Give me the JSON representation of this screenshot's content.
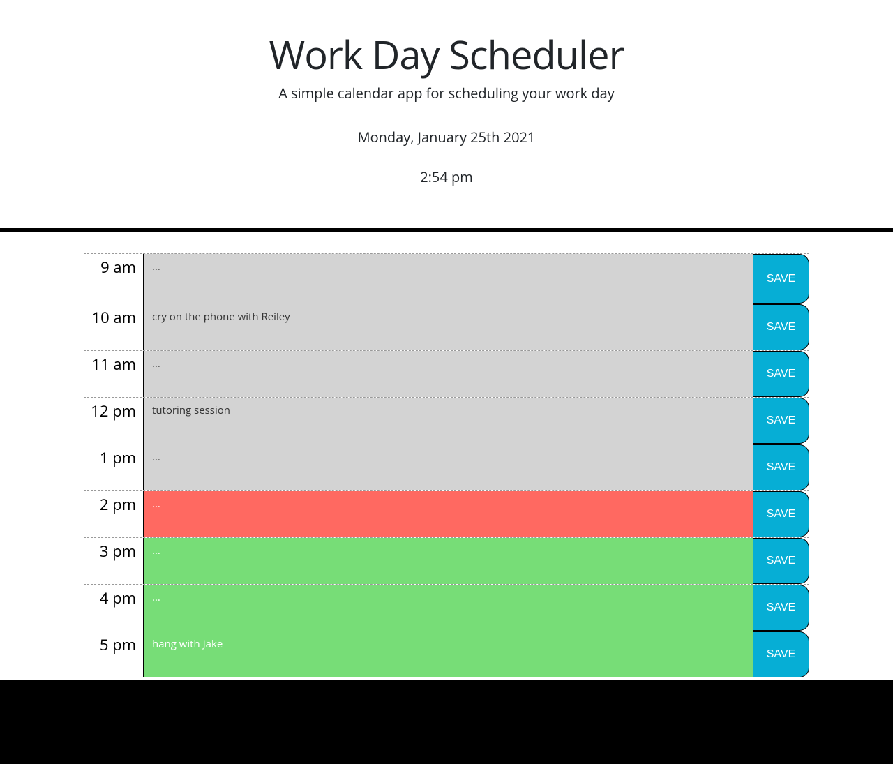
{
  "header": {
    "title": "Work Day Scheduler",
    "subtitle": "A simple calendar app for scheduling your work day",
    "current_date": "Monday, January 25th 2021",
    "current_time": "2:54 pm"
  },
  "colors": {
    "past": "#d3d3d3",
    "present": "#ff6961",
    "future": "#77dd77",
    "save_button": "#06aed5"
  },
  "rows": [
    {
      "hour": "9 am",
      "state": "past",
      "value": "",
      "placeholder": "...",
      "save_label": "SAVE"
    },
    {
      "hour": "10 am",
      "state": "past",
      "value": "cry on the phone with Reiley",
      "placeholder": "...",
      "save_label": "SAVE"
    },
    {
      "hour": "11 am",
      "state": "past",
      "value": "",
      "placeholder": "...",
      "save_label": "SAVE"
    },
    {
      "hour": "12 pm",
      "state": "past",
      "value": "tutoring session",
      "placeholder": "...",
      "save_label": "SAVE"
    },
    {
      "hour": "1 pm",
      "state": "past",
      "value": "",
      "placeholder": "...",
      "save_label": "SAVE"
    },
    {
      "hour": "2 pm",
      "state": "present",
      "value": "",
      "placeholder": "...",
      "save_label": "SAVE"
    },
    {
      "hour": "3 pm",
      "state": "future",
      "value": "",
      "placeholder": "...",
      "save_label": "SAVE"
    },
    {
      "hour": "4 pm",
      "state": "future",
      "value": "",
      "placeholder": "...",
      "save_label": "SAVE"
    },
    {
      "hour": "5 pm",
      "state": "future",
      "value": "hang with Jake",
      "placeholder": "...",
      "save_label": "SAVE"
    }
  ]
}
